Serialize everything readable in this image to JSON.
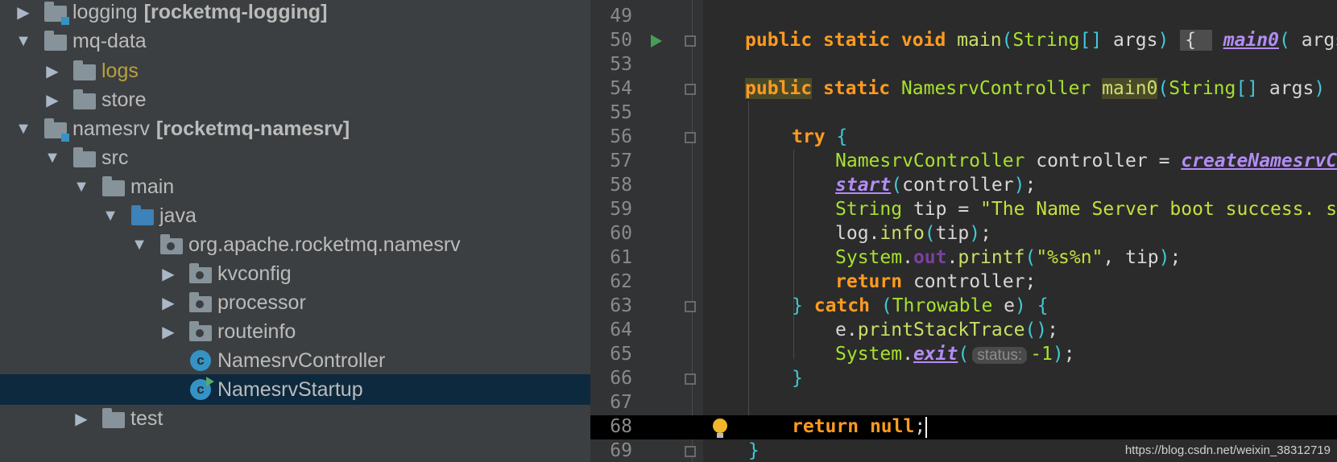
{
  "project_tree": {
    "rows": [
      {
        "label": "logging",
        "module": "[rocketmq-logging]"
      },
      {
        "label": "mq-data"
      },
      {
        "label": "logs"
      },
      {
        "label": "store"
      },
      {
        "label": "namesrv",
        "module": "[rocketmq-namesrv]"
      },
      {
        "label": "src"
      },
      {
        "label": "main"
      },
      {
        "label": "java"
      },
      {
        "label": "org.apache.rocketmq.namesrv"
      },
      {
        "label": "kvconfig"
      },
      {
        "label": "processor"
      },
      {
        "label": "routeinfo"
      },
      {
        "label": "NamesrvController"
      },
      {
        "label": "NamesrvStartup"
      },
      {
        "label": "test"
      }
    ],
    "expand_glyph": "▶",
    "collapse_glyph": "▼",
    "class_glyph": "c"
  },
  "editor": {
    "line_numbers": [
      "49",
      "50",
      "53",
      "54",
      "55",
      "56",
      "57",
      "58",
      "59",
      "60",
      "61",
      "62",
      "63",
      "64",
      "65",
      "66",
      "67",
      "68",
      "69"
    ],
    "tokens": {
      "public": "public",
      "static": "static",
      "void": "void",
      "main": "main",
      "lparen": "(",
      "rparen": ")",
      "string_type": "String",
      "brackets": "[]",
      "args": " args",
      "open_brace": "{",
      "close_brace": "}",
      "folded_open": "{ ",
      "main0": "main0",
      "controller_type": "NamesrvController",
      "try": "try",
      "catch": "catch",
      "throwable": "Throwable",
      "e": " e",
      "controller_var": " controller = ",
      "create": "createNamesrvC",
      "start": "start",
      "controller": "controller",
      "semicolon": ";",
      "tip_decl": " tip = ",
      "tip_str": "\"The Name Server boot success. s",
      "log": "log",
      "dot": ".",
      "info": "info",
      "tip": "tip",
      "system": "System",
      "out": "out",
      "printf": "printf",
      "fmt_str": "\"%s%n\"",
      "comma": ", ",
      "return": "return",
      "e_var": "e",
      "print_stack": "printStackTrace",
      "exit": "exit",
      "status_hint": "status:",
      "minus_one": "-1",
      "null": "null"
    }
  },
  "watermark": "https://blog.csdn.net/weixin_38312719",
  "colors": {
    "tree_bg": "#3c3f41",
    "editor_bg": "#2b2b2b",
    "selected_row": "#0d293e",
    "keyword": "#ff9b1f",
    "string": "#c5e03c",
    "current_line": "#000000"
  }
}
